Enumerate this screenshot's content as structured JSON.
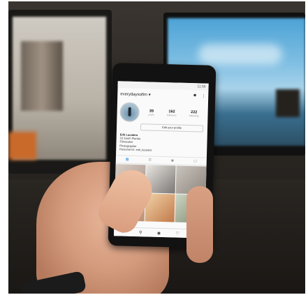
{
  "phone_screen": {
    "status_time": "11:56",
    "username": "everydaysofim",
    "username_caret": "▾",
    "icons": [
      "add-person-icon",
      "more-icon"
    ],
    "stats": [
      {
        "value": "39",
        "label": "posts"
      },
      {
        "value": "162",
        "label": "followers"
      },
      {
        "value": "222",
        "label": "following"
      }
    ],
    "edit_profile_label": "Edit your profile",
    "bio": {
      "name": "Erik Lucatero",
      "lines": [
        "23 South Florida",
        "Filmmaker",
        "Photographer",
        "Personal IG: erik_lucatero"
      ]
    },
    "view_tabs": [
      "grid-icon",
      "list-icon",
      "location-icon",
      "tag-icon"
    ],
    "bottom_nav": [
      "home-icon",
      "search-icon",
      "camera-icon",
      "heart-icon",
      "profile-icon"
    ]
  }
}
